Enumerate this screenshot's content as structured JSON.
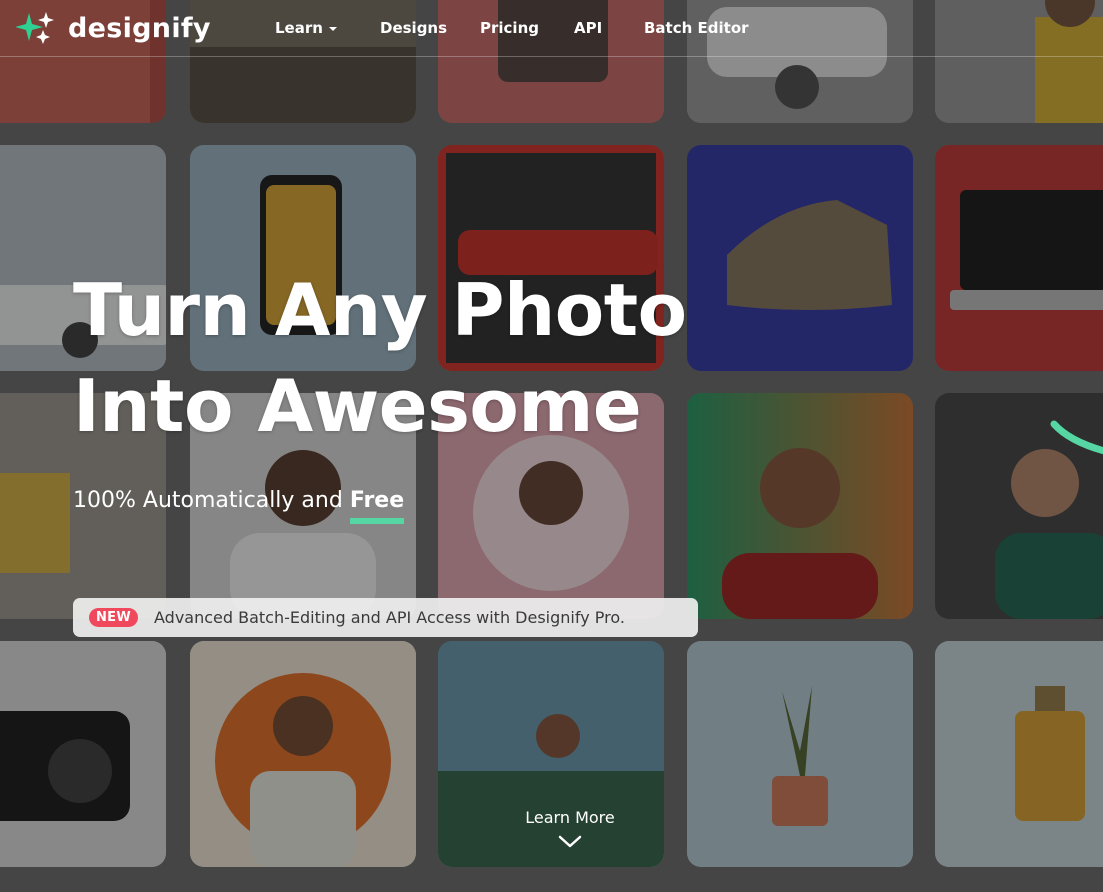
{
  "brand": {
    "name": "designify",
    "logo_icon": "sparkle-stars-icon",
    "accent": "#55d6a2"
  },
  "nav": {
    "items": [
      {
        "label": "Learn",
        "has_dropdown": true
      },
      {
        "label": "Designs"
      },
      {
        "label": "Pricing"
      },
      {
        "label": "API"
      },
      {
        "label": "Batch Editor"
      }
    ]
  },
  "hero": {
    "title_line1": "Turn Any Photo",
    "title_line2": "Into Awesome",
    "subtitle_prefix": "100% Automatically and ",
    "subtitle_emphasis": "Free"
  },
  "announcement": {
    "badge": "NEW",
    "text": "Advanced Batch-Editing and API Access with Designify Pro.",
    "badge_color": "#f0495e"
  },
  "cta": {
    "learn_more": "Learn More",
    "icon": "chevron-down-icon"
  },
  "background_tiles": [
    "red-jacket-photo",
    "car-photo",
    "phone-photo",
    "white-suv-photo",
    "woman-yellow-photo",
    "white-car-photo",
    "smartphone-photo",
    "red-car-photo",
    "sneakers-photo",
    "laptop-photo",
    "perfume-bottle-photo",
    "bearded-man-photo",
    "woman-portrait-photo",
    "man-portrait-photo",
    "woman-smiling-photo",
    "camera-photo",
    "headphones-man-photo",
    "woman-beach-photo",
    "plant-pot-photo",
    "perfume-photo"
  ]
}
